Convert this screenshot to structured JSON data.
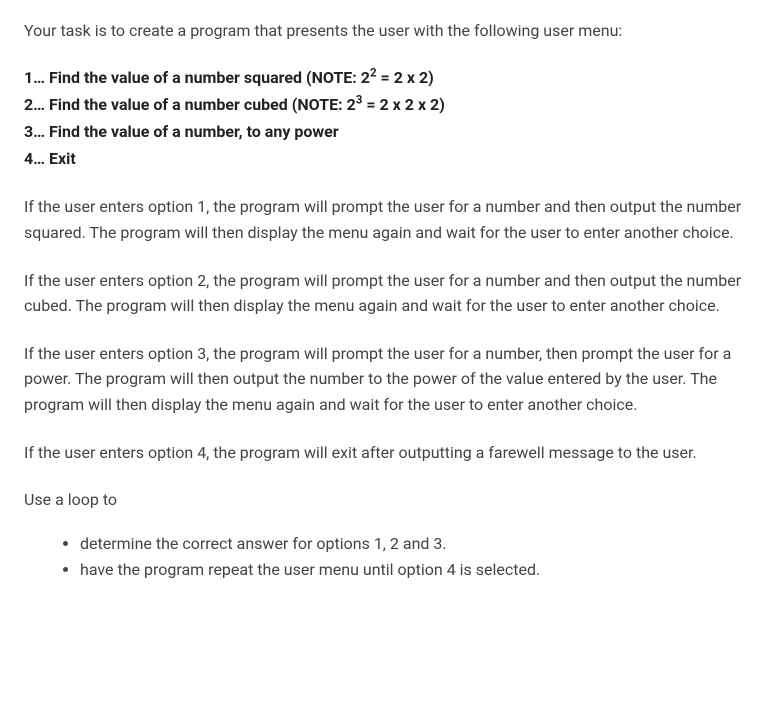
{
  "intro": "Your task is to create a program that presents the user with the following user menu:",
  "menu": {
    "items": [
      {
        "prefix": "1… Find the value of a number squared (NOTE: 2",
        "sup": "2",
        "suffix": " = 2 x 2)"
      },
      {
        "prefix": "2… Find the value of a number cubed (NOTE: 2",
        "sup": "3",
        "suffix": " = 2 x 2 x 2)"
      },
      {
        "prefix": "3… Find the value of a number, to any power",
        "sup": "",
        "suffix": ""
      },
      {
        "prefix": "4… Exit",
        "sup": "",
        "suffix": ""
      }
    ]
  },
  "paragraphs": {
    "p1": "If the user enters option 1, the program will prompt the user for a number and then output the number squared. The program will then display the menu again and wait for the user to enter another choice.",
    "p2": "If the user enters option 2, the program will prompt the user for a number and then output the number cubed. The program will then display the menu again and wait for the user to enter another choice.",
    "p3": "If the user enters option 3, the program will prompt the user for a number, then prompt the user for a power. The program will then output the number to the power of the value entered by the user. The program will then display the menu again and wait for the user to enter another choice.",
    "p4": "If the user enters option 4, the program will exit after outputting a farewell message to the user."
  },
  "loop_intro": "Use a loop to",
  "bullets": [
    "determine the correct answer for options 1, 2 and 3.",
    "have the program repeat the user menu until option 4 is selected."
  ]
}
